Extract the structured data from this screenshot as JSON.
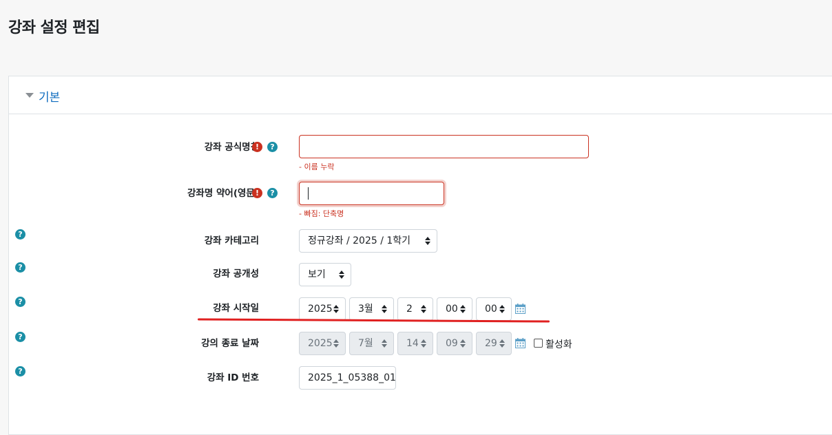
{
  "page": {
    "title": "강좌 설정 편집"
  },
  "section": {
    "title": "기본"
  },
  "form": {
    "fullname": {
      "label": "강좌 공식명칭",
      "value": "",
      "error": "- 이름 누락"
    },
    "shortname": {
      "label": "강좌명 약어(영문)",
      "value": "",
      "error": "- 빠짐: 단축명"
    },
    "category": {
      "label": "강좌 카테고리",
      "value": "정규강좌 / 2025 / 1학기"
    },
    "visibility": {
      "label": "강좌 공개성",
      "value": "보기"
    },
    "startdate": {
      "label": "강좌 시작일",
      "year": "2025",
      "month": "3월",
      "day": "2",
      "hour": "00",
      "minute": "00"
    },
    "enddate": {
      "label": "강의 종료 날짜",
      "year": "2025",
      "month": "7월",
      "day": "14",
      "hour": "09",
      "minute": "29",
      "enable_label": "활성화",
      "enabled": false
    },
    "idnumber": {
      "label": "강좌 ID 번호",
      "value": "2025_1_05388_01"
    }
  },
  "icons": {
    "required": "exclamation-circle-icon",
    "help": "question-circle-icon",
    "calendar": "calendar-icon",
    "collapse": "caret-down-icon"
  },
  "colors": {
    "link": "#0f6cbf",
    "error": "#ca3120",
    "help": "#1b8fa6",
    "annotation": "#e02020"
  }
}
